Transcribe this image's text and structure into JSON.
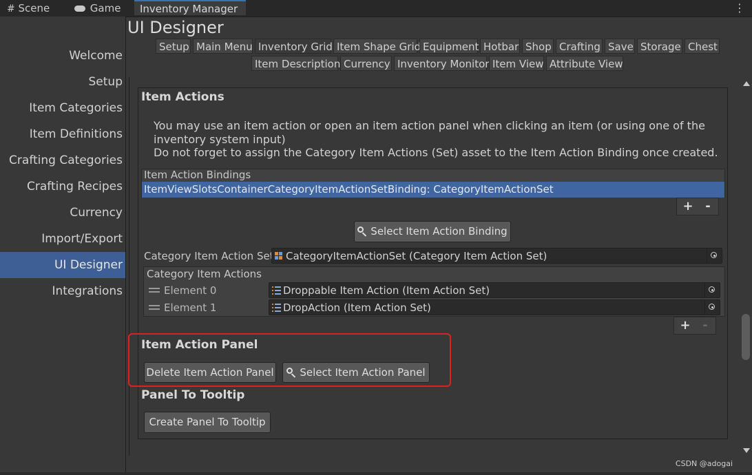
{
  "top_tabs": [
    {
      "label": "Scene",
      "icon": "hash-icon"
    },
    {
      "label": "Game",
      "icon": "gamepad-icon"
    },
    {
      "label": "Inventory Manager",
      "active": true
    }
  ],
  "sidebar": {
    "items": [
      {
        "label": "Welcome"
      },
      {
        "label": "Setup"
      },
      {
        "label": "Item Categories"
      },
      {
        "label": "Item Definitions"
      },
      {
        "label": "Crafting Categories"
      },
      {
        "label": "Crafting Recipes"
      },
      {
        "label": "Currency"
      },
      {
        "label": "Import/Export"
      },
      {
        "label": "UI Designer",
        "active": true
      },
      {
        "label": "Integrations"
      }
    ]
  },
  "page": {
    "title": "UI Designer"
  },
  "designer_tabs": {
    "row1": [
      "Setup",
      "Main Menu",
      "Inventory Grid",
      "Item Shape Grid",
      "Equipment",
      "Hotbar",
      "Shop",
      "Crafting",
      "Save",
      "Storage",
      "Chest"
    ],
    "row2": [
      "Item Description",
      "Currency",
      "Inventory Monitor",
      "Item View",
      "Attribute View"
    ],
    "active": "Inventory Grid"
  },
  "item_actions": {
    "heading": "Item Actions",
    "description_line1": "You may use an item action or open an item action panel when clicking an item (or using one of the",
    "description_line2": "inventory system input)",
    "description_line3": "Do not forget to assign the Category Item Actions (Set) asset to the Item Action Binding once created.",
    "bindings_header": "Item Action Bindings",
    "bindings": [
      "ItemViewSlotsContainerCategoryItemActionSetBinding: CategoryItemActionSet"
    ],
    "add_label": "+",
    "remove_label": "-",
    "select_binding_label": "Select Item Action Binding",
    "category_set_label": "Category Item Action Set",
    "category_set_value": "CategoryItemActionSet (Category Item Action Set)",
    "category_actions_header": "Category Item Actions",
    "elements": [
      {
        "label": "Element 0",
        "value": "Droppable Item Action (Item Action Set)"
      },
      {
        "label": "Element 1",
        "value": "DropAction (Item Action Set)"
      }
    ]
  },
  "item_action_panel": {
    "heading": "Item Action Panel",
    "delete_label": "Delete Item Action Panel",
    "select_label": "Select Item Action Panel"
  },
  "panel_to_tooltip": {
    "heading": "Panel To Tooltip",
    "create_label": "Create Panel To Tooltip"
  },
  "watermark": "CSDN @adogai",
  "colors": {
    "accent": "#3e5f96",
    "highlight": "#e02020",
    "selection": "#3f66a0"
  }
}
